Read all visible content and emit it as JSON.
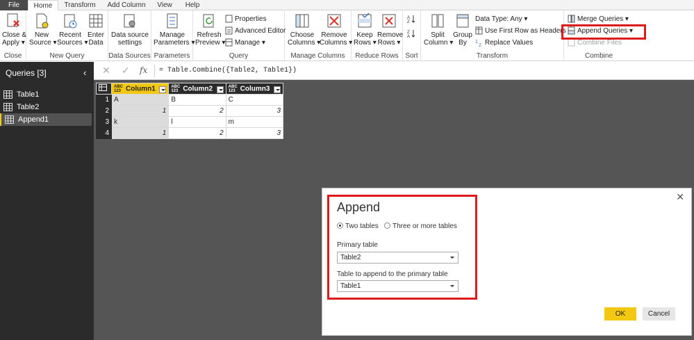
{
  "tabs": [
    "File",
    "Home",
    "Transform",
    "Add Column",
    "View",
    "Help"
  ],
  "ribbon": {
    "close_group": {
      "label": "Close",
      "close_apply": "Close &",
      "close_apply2": "Apply ▾"
    },
    "new_query_group": {
      "label": "New Query",
      "new_source": "New",
      "new_source2": "Source ▾",
      "recent_sources": "Recent",
      "recent_sources2": "Sources ▾",
      "enter_data": "Enter",
      "enter_data2": "Data"
    },
    "data_sources_group": {
      "label": "Data Sources",
      "ds_settings": "Data source",
      "ds_settings2": "settings"
    },
    "parameters_group": {
      "label": "Parameters",
      "manage_params": "Manage",
      "manage_params2": "Parameters ▾"
    },
    "query_group": {
      "label": "Query",
      "refresh": "Refresh",
      "refresh2": "Preview ▾",
      "properties": "Properties",
      "advanced_editor": "Advanced Editor",
      "manage": "Manage ▾"
    },
    "manage_columns_group": {
      "label": "Manage Columns",
      "choose": "Choose",
      "choose2": "Columns ▾",
      "remove": "Remove",
      "remove2": "Columns ▾"
    },
    "reduce_rows_group": {
      "label": "Reduce Rows",
      "keep": "Keep",
      "keep2": "Rows ▾",
      "remove": "Remove",
      "remove2": "Rows ▾"
    },
    "sort_group": {
      "label": "Sort"
    },
    "transform_group": {
      "label": "Transform",
      "split": "Split",
      "split2": "Column ▾",
      "group": "Group",
      "group2": "By",
      "data_type": "Data Type: Any ▾",
      "first_row": "Use First Row as Headers ▾",
      "replace": "Replace Values"
    },
    "combine_group": {
      "label": "Combine",
      "merge": "Merge Queries ▾",
      "append": "Append Queries ▾",
      "combine_files": "Combine Files"
    }
  },
  "queries": {
    "header": "Queries [3]",
    "items": [
      "Table1",
      "Table2",
      "Append1"
    ],
    "selected": "Append1"
  },
  "formula": "= Table.Combine({Table2, Table1})",
  "grid": {
    "columns": [
      "Column1",
      "Column2",
      "Column3"
    ],
    "type_badge": "ABC\n123",
    "rows": [
      {
        "n": "1",
        "c": [
          "A",
          "B",
          "C"
        ]
      },
      {
        "n": "2",
        "c": [
          "1",
          "2",
          "3"
        ]
      },
      {
        "n": "3",
        "c": [
          "k",
          "l",
          "m"
        ]
      },
      {
        "n": "4",
        "c": [
          "1",
          "2",
          "3"
        ]
      }
    ]
  },
  "dialog": {
    "title": "Append",
    "option_two": "Two tables",
    "option_more": "Three or more tables",
    "primary_label": "Primary table",
    "primary_value": "Table2",
    "append_label": "Table to append to the primary table",
    "append_value": "Table1",
    "ok": "OK",
    "cancel": "Cancel"
  },
  "colors": {
    "accent": "#f2c811",
    "highlight": "#e0191d",
    "pane": "#2b2b2b"
  }
}
